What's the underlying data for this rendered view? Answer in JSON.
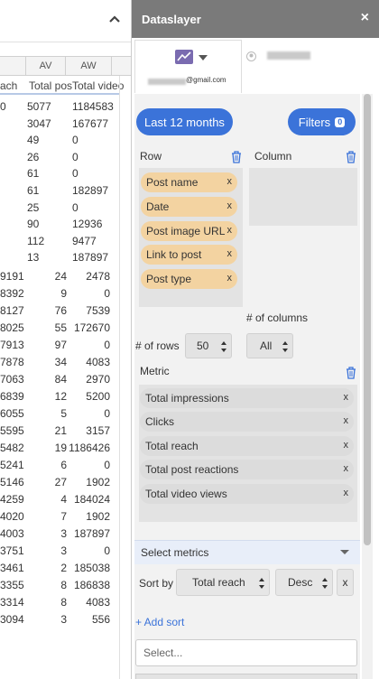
{
  "sheet": {
    "columns": [
      "AV",
      "AW"
    ],
    "headers": [
      "ach",
      "Total pos",
      "Total video"
    ],
    "top_rows": [
      [
        "0",
        "5077",
        "1184583"
      ],
      [
        "",
        "3047",
        "167677"
      ],
      [
        "",
        "49",
        "0"
      ],
      [
        "",
        "26",
        "0"
      ],
      [
        "",
        "61",
        "0"
      ],
      [
        "",
        "61",
        "182897"
      ],
      [
        "",
        "25",
        "0"
      ],
      [
        "",
        "90",
        "12936"
      ],
      [
        "",
        "112",
        "9477"
      ],
      [
        "",
        "13",
        "187897"
      ]
    ],
    "bottom_rows": [
      [
        "9191",
        "24",
        "2478"
      ],
      [
        "8392",
        "9",
        "0"
      ],
      [
        "8127",
        "76",
        "7539"
      ],
      [
        "8025",
        "55",
        "172670"
      ],
      [
        "7913",
        "97",
        "0"
      ],
      [
        "7878",
        "34",
        "4083"
      ],
      [
        "7063",
        "84",
        "2970"
      ],
      [
        "6839",
        "12",
        "5200"
      ],
      [
        "6055",
        "5",
        "0"
      ],
      [
        "5595",
        "21",
        "3157"
      ],
      [
        "5482",
        "19",
        "1186426"
      ],
      [
        "5241",
        "6",
        "0"
      ],
      [
        "5146",
        "27",
        "1902"
      ],
      [
        "4259",
        "4",
        "184024"
      ],
      [
        "4020",
        "7",
        "1902"
      ],
      [
        "4003",
        "3",
        "187897"
      ],
      [
        "3751",
        "3",
        "0"
      ],
      [
        "3461",
        "2",
        "185038"
      ],
      [
        "3355",
        "8",
        "186838"
      ],
      [
        "3314",
        "8",
        "4083"
      ],
      [
        "3094",
        "3",
        "556"
      ]
    ]
  },
  "panel": {
    "title": "Dataslayer",
    "close": "×",
    "account_email_suffix": "@gmail.com",
    "date_button": "Last 12 months",
    "filters_button": "Filters",
    "filters_count": "0",
    "row_label": "Row",
    "column_label": "Column",
    "row_chips": [
      "Post name",
      "Date",
      "Post image URL",
      "Link to post",
      "Post type"
    ],
    "num_columns_label": "# of columns",
    "num_rows_label": "# of rows",
    "num_rows_value": "50",
    "num_columns_value": "All",
    "metric_label": "Metric",
    "metric_chips": [
      "Total impressions",
      "Clicks",
      "Total reach",
      "Total post reactions",
      "Total video views"
    ],
    "select_metrics": "Select metrics",
    "sort_by_label": "Sort by",
    "sort_field": "Total reach",
    "sort_order": "Desc",
    "sort_remove": "x",
    "add_sort": "+ Add sort",
    "select_placeholder": "Select...",
    "chip_remove": "x"
  }
}
